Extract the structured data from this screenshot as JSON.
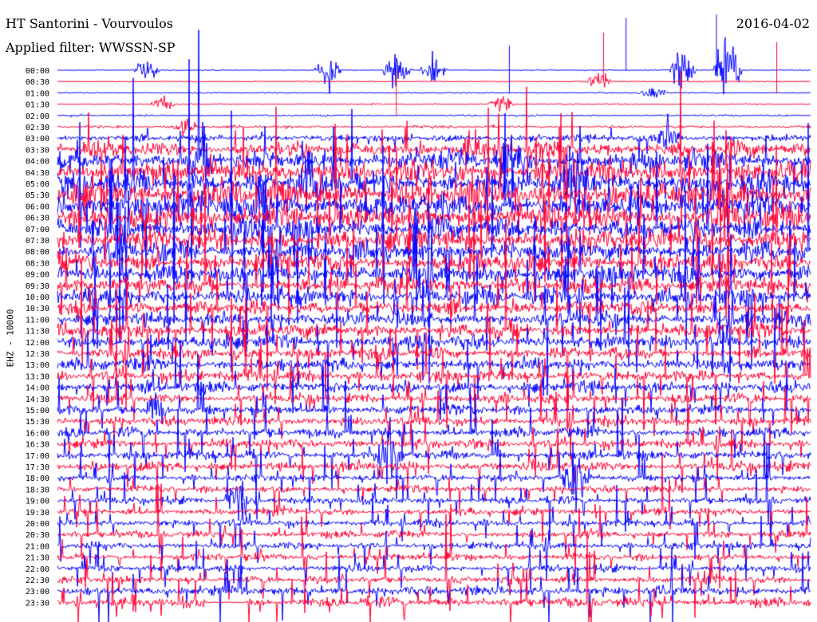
{
  "header": {
    "station": "HT Santorini - Vourvoulos",
    "filter": "Applied filter: WWSSN-SP",
    "date": "2016-04-02"
  },
  "chart_data": {
    "type": "line",
    "description_kind": "helicorder",
    "ylabel": "EHZ - 10000",
    "row_labels": [
      "00:00",
      "00:30",
      "01:00",
      "01:30",
      "02:00",
      "02:30",
      "03:00",
      "03:30",
      "04:00",
      "04:30",
      "05:00",
      "05:30",
      "06:00",
      "06:30",
      "07:00",
      "07:30",
      "08:00",
      "08:30",
      "09:00",
      "09:30",
      "10:00",
      "10:30",
      "11:00",
      "11:30",
      "12:00",
      "12:30",
      "13:00",
      "13:30",
      "14:00",
      "14:30",
      "15:00",
      "15:30",
      "16:00",
      "16:30",
      "17:00",
      "17:30",
      "18:00",
      "18:30",
      "19:00",
      "19:30",
      "20:00",
      "20:30",
      "21:00",
      "21:30",
      "22:00",
      "22:30",
      "23:00",
      "23:30"
    ],
    "series_colors": [
      "#0000ff",
      "#ff0033"
    ],
    "line_noise_level": [
      0.2,
      0.2,
      0.3,
      0.3,
      0.4,
      0.6,
      1.5,
      3.0,
      4.0,
      4.5,
      5.0,
      5.5,
      5.5,
      5.0,
      4.5,
      4.5,
      4.0,
      4.0,
      4.0,
      3.5,
      3.5,
      3.0,
      3.0,
      3.0,
      3.0,
      2.5,
      2.5,
      2.5,
      2.5,
      2.0,
      2.0,
      2.0,
      2.0,
      2.0,
      2.0,
      2.0,
      1.5,
      1.5,
      1.5,
      1.5,
      1.5,
      1.5,
      1.5,
      1.5,
      1.5,
      1.5,
      2.0,
      2.0
    ],
    "events": [
      {
        "row": 0,
        "x": 0.12,
        "amp": 1.5
      },
      {
        "row": 0,
        "x": 0.83,
        "amp": 3.0
      },
      {
        "row": 0,
        "x": 0.89,
        "amp": 6.0
      },
      {
        "row": 0,
        "x": 0.36,
        "amp": 2.5
      },
      {
        "row": 0,
        "x": 0.45,
        "amp": 3.0
      },
      {
        "row": 0,
        "x": 0.5,
        "amp": 2.0
      },
      {
        "row": 1,
        "x": 0.72,
        "amp": 1.5
      },
      {
        "row": 2,
        "x": 0.79,
        "amp": 1.0
      },
      {
        "row": 3,
        "x": 0.14,
        "amp": 1.0
      },
      {
        "row": 3,
        "x": 0.59,
        "amp": 1.0
      },
      {
        "row": 5,
        "x": 0.17,
        "amp": 1.0
      },
      {
        "row": 6,
        "x": 0.81,
        "amp": 2.0
      },
      {
        "row": 7,
        "x": 0.55,
        "amp": 2.0
      },
      {
        "row": 8,
        "x": 0.19,
        "amp": 3.0
      },
      {
        "row": 8,
        "x": 0.6,
        "amp": 2.5
      },
      {
        "row": 10,
        "x": 0.33,
        "amp": 3.0
      },
      {
        "row": 10,
        "x": 0.69,
        "amp": 2.5
      },
      {
        "row": 12,
        "x": 0.27,
        "amp": 2.5
      },
      {
        "row": 30,
        "x": 0.13,
        "amp": 2.0
      },
      {
        "row": 34,
        "x": 0.44,
        "amp": 4.0
      },
      {
        "row": 36,
        "x": 0.69,
        "amp": 5.0
      },
      {
        "row": 38,
        "x": 0.24,
        "amp": 3.0
      }
    ],
    "gaps": [
      {
        "row": 47,
        "x_start": 0.195,
        "x_end": 0.25
      }
    ]
  }
}
